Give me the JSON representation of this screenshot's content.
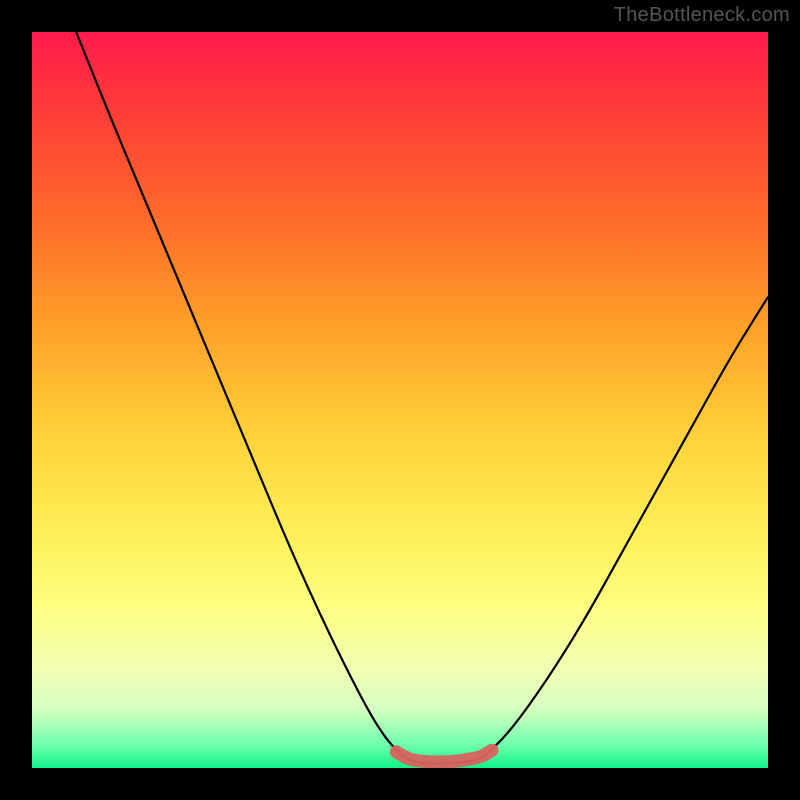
{
  "watermark": "TheBottleneck.com",
  "colors": {
    "background": "#000000",
    "curve": "#000000",
    "marker": "#d9625f"
  },
  "chart_data": {
    "type": "line",
    "title": "",
    "xlabel": "",
    "ylabel": "",
    "xlim": [
      0,
      100
    ],
    "ylim": [
      0,
      100
    ],
    "grid": false,
    "legend": false,
    "description": "Bottleneck curve: percentage bottleneck (y) vs component balance (x). Two descending/ascending curves meeting at a flat optimal region near the bottom.",
    "series": [
      {
        "name": "left-curve",
        "x": [
          6,
          10,
          15,
          20,
          25,
          30,
          35,
          40,
          45,
          48,
          50.5
        ],
        "y": [
          100,
          90,
          78,
          66,
          54,
          42,
          30,
          19,
          9,
          4,
          1.5
        ]
      },
      {
        "name": "floor",
        "x": [
          50.5,
          52,
          54,
          56,
          58,
          60,
          61.5
        ],
        "y": [
          1.5,
          0.8,
          0.6,
          0.6,
          0.7,
          1.0,
          1.6
        ]
      },
      {
        "name": "right-curve",
        "x": [
          61.5,
          65,
          70,
          75,
          80,
          85,
          90,
          95,
          100
        ],
        "y": [
          1.6,
          5,
          12,
          20,
          29,
          38,
          47,
          56,
          64
        ]
      }
    ],
    "optimal_region": {
      "x": [
        49.5,
        51,
        53,
        55,
        57,
        59,
        61,
        62.5
      ],
      "y": [
        2.2,
        1.2,
        0.9,
        0.8,
        0.85,
        1.1,
        1.5,
        2.4
      ]
    }
  }
}
